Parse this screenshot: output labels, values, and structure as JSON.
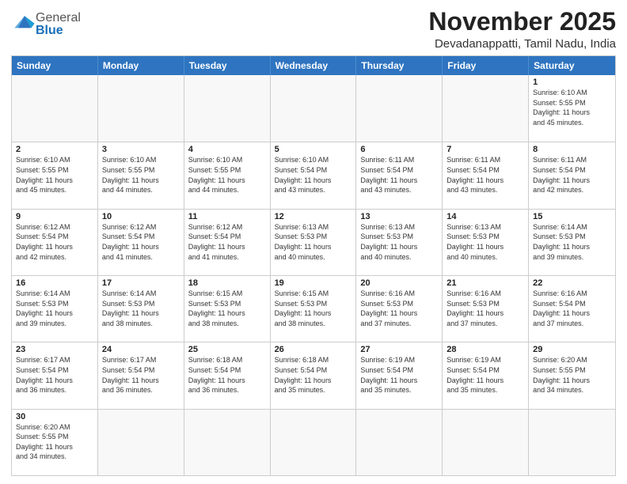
{
  "header": {
    "logo_general": "General",
    "logo_blue": "Blue",
    "month_title": "November 2025",
    "location": "Devadanappatti, Tamil Nadu, India"
  },
  "day_headers": [
    "Sunday",
    "Monday",
    "Tuesday",
    "Wednesday",
    "Thursday",
    "Friday",
    "Saturday"
  ],
  "weeks": [
    [
      {
        "day": "",
        "info": ""
      },
      {
        "day": "",
        "info": ""
      },
      {
        "day": "",
        "info": ""
      },
      {
        "day": "",
        "info": ""
      },
      {
        "day": "",
        "info": ""
      },
      {
        "day": "",
        "info": ""
      },
      {
        "day": "1",
        "info": "Sunrise: 6:10 AM\nSunset: 5:55 PM\nDaylight: 11 hours\nand 45 minutes."
      }
    ],
    [
      {
        "day": "2",
        "info": "Sunrise: 6:10 AM\nSunset: 5:55 PM\nDaylight: 11 hours\nand 45 minutes."
      },
      {
        "day": "3",
        "info": "Sunrise: 6:10 AM\nSunset: 5:55 PM\nDaylight: 11 hours\nand 44 minutes."
      },
      {
        "day": "4",
        "info": "Sunrise: 6:10 AM\nSunset: 5:55 PM\nDaylight: 11 hours\nand 44 minutes."
      },
      {
        "day": "5",
        "info": "Sunrise: 6:10 AM\nSunset: 5:54 PM\nDaylight: 11 hours\nand 43 minutes."
      },
      {
        "day": "6",
        "info": "Sunrise: 6:11 AM\nSunset: 5:54 PM\nDaylight: 11 hours\nand 43 minutes."
      },
      {
        "day": "7",
        "info": "Sunrise: 6:11 AM\nSunset: 5:54 PM\nDaylight: 11 hours\nand 43 minutes."
      },
      {
        "day": "8",
        "info": "Sunrise: 6:11 AM\nSunset: 5:54 PM\nDaylight: 11 hours\nand 42 minutes."
      }
    ],
    [
      {
        "day": "9",
        "info": "Sunrise: 6:12 AM\nSunset: 5:54 PM\nDaylight: 11 hours\nand 42 minutes."
      },
      {
        "day": "10",
        "info": "Sunrise: 6:12 AM\nSunset: 5:54 PM\nDaylight: 11 hours\nand 41 minutes."
      },
      {
        "day": "11",
        "info": "Sunrise: 6:12 AM\nSunset: 5:54 PM\nDaylight: 11 hours\nand 41 minutes."
      },
      {
        "day": "12",
        "info": "Sunrise: 6:13 AM\nSunset: 5:53 PM\nDaylight: 11 hours\nand 40 minutes."
      },
      {
        "day": "13",
        "info": "Sunrise: 6:13 AM\nSunset: 5:53 PM\nDaylight: 11 hours\nand 40 minutes."
      },
      {
        "day": "14",
        "info": "Sunrise: 6:13 AM\nSunset: 5:53 PM\nDaylight: 11 hours\nand 40 minutes."
      },
      {
        "day": "15",
        "info": "Sunrise: 6:14 AM\nSunset: 5:53 PM\nDaylight: 11 hours\nand 39 minutes."
      }
    ],
    [
      {
        "day": "16",
        "info": "Sunrise: 6:14 AM\nSunset: 5:53 PM\nDaylight: 11 hours\nand 39 minutes."
      },
      {
        "day": "17",
        "info": "Sunrise: 6:14 AM\nSunset: 5:53 PM\nDaylight: 11 hours\nand 38 minutes."
      },
      {
        "day": "18",
        "info": "Sunrise: 6:15 AM\nSunset: 5:53 PM\nDaylight: 11 hours\nand 38 minutes."
      },
      {
        "day": "19",
        "info": "Sunrise: 6:15 AM\nSunset: 5:53 PM\nDaylight: 11 hours\nand 38 minutes."
      },
      {
        "day": "20",
        "info": "Sunrise: 6:16 AM\nSunset: 5:53 PM\nDaylight: 11 hours\nand 37 minutes."
      },
      {
        "day": "21",
        "info": "Sunrise: 6:16 AM\nSunset: 5:53 PM\nDaylight: 11 hours\nand 37 minutes."
      },
      {
        "day": "22",
        "info": "Sunrise: 6:16 AM\nSunset: 5:54 PM\nDaylight: 11 hours\nand 37 minutes."
      }
    ],
    [
      {
        "day": "23",
        "info": "Sunrise: 6:17 AM\nSunset: 5:54 PM\nDaylight: 11 hours\nand 36 minutes."
      },
      {
        "day": "24",
        "info": "Sunrise: 6:17 AM\nSunset: 5:54 PM\nDaylight: 11 hours\nand 36 minutes."
      },
      {
        "day": "25",
        "info": "Sunrise: 6:18 AM\nSunset: 5:54 PM\nDaylight: 11 hours\nand 36 minutes."
      },
      {
        "day": "26",
        "info": "Sunrise: 6:18 AM\nSunset: 5:54 PM\nDaylight: 11 hours\nand 35 minutes."
      },
      {
        "day": "27",
        "info": "Sunrise: 6:19 AM\nSunset: 5:54 PM\nDaylight: 11 hours\nand 35 minutes."
      },
      {
        "day": "28",
        "info": "Sunrise: 6:19 AM\nSunset: 5:54 PM\nDaylight: 11 hours\nand 35 minutes."
      },
      {
        "day": "29",
        "info": "Sunrise: 6:20 AM\nSunset: 5:55 PM\nDaylight: 11 hours\nand 34 minutes."
      }
    ],
    [
      {
        "day": "30",
        "info": "Sunrise: 6:20 AM\nSunset: 5:55 PM\nDaylight: 11 hours\nand 34 minutes."
      },
      {
        "day": "",
        "info": ""
      },
      {
        "day": "",
        "info": ""
      },
      {
        "day": "",
        "info": ""
      },
      {
        "day": "",
        "info": ""
      },
      {
        "day": "",
        "info": ""
      },
      {
        "day": "",
        "info": ""
      }
    ]
  ]
}
